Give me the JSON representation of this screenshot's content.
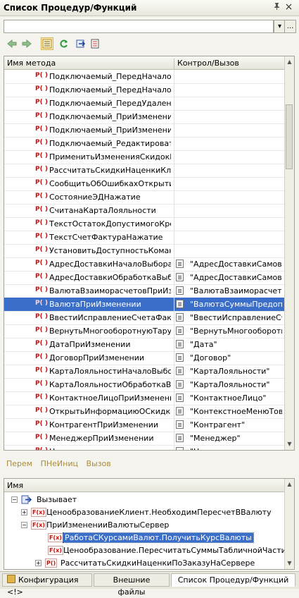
{
  "window": {
    "title": "Список Процедур/Функций",
    "pin_icon": "pin-icon",
    "close_glyph": "×"
  },
  "search": {
    "value": "",
    "dots": "...",
    "dropdown": "▾"
  },
  "grid": {
    "columns": [
      "Имя метода",
      "Контрол/Вызов"
    ],
    "rows": [
      {
        "name": "Подключаемый_ПередНачало...",
        "control": ""
      },
      {
        "name": "Подключаемый_ПередНачало...",
        "control": ""
      },
      {
        "name": "Подключаемый_ПередУдален...",
        "control": ""
      },
      {
        "name": "Подключаемый_ПриИзменени...",
        "control": ""
      },
      {
        "name": "Подключаемый_ПриИзменени...",
        "control": ""
      },
      {
        "name": "Подключаемый_Редактироват...",
        "control": ""
      },
      {
        "name": "ПрименитьИзмененияСкидокН...",
        "control": ""
      },
      {
        "name": "РассчитатьСкидкиНаценкиКли...",
        "control": ""
      },
      {
        "name": "СообщитьОбОшибкахОткрытия...",
        "control": ""
      },
      {
        "name": "СостояниеЭДНажатие",
        "control": ""
      },
      {
        "name": "СчитанаКартаЛояльности",
        "control": ""
      },
      {
        "name": "ТекстОстатокДопустимогоКре...",
        "control": ""
      },
      {
        "name": "ТекстСчетФактураНажатие",
        "control": ""
      },
      {
        "name": "УстановитьДоступностьКоман...",
        "control": ""
      },
      {
        "name": "АдресДоставкиНачалоВыбора",
        "control": "\"АдресДоставкиСамов..."
      },
      {
        "name": "АдресДоставкиОбработкаВыб...",
        "control": "\"АдресДоставкиСамов..."
      },
      {
        "name": "ВалютаВзаиморасчетовПриИз...",
        "control": "\"ВалютаВзаиморасчет..."
      },
      {
        "name": "ВалютаПриИзменении",
        "control": "\"ВалютаСуммыПредоп...",
        "selected": true
      },
      {
        "name": "ВвестиИсправлениеСчетаФак...",
        "control": "\"ВвестиИсправлениеСч..."
      },
      {
        "name": "ВернутьМногооборотнуюТаруП...",
        "control": "\"ВернутьМногооборотн..."
      },
      {
        "name": "ДатаПриИзменении",
        "control": "\"Дата\""
      },
      {
        "name": "ДоговорПриИзменении",
        "control": "\"Договор\""
      },
      {
        "name": "КартаЛояльностиНачалоВыбора",
        "control": "\"КартаЛояльности\""
      },
      {
        "name": "КартаЛояльностиОбработкаВ...",
        "control": "\"КартаЛояльности\""
      },
      {
        "name": "КонтактноеЛицоПриИзменении",
        "control": "\"КонтактноеЛицо\""
      },
      {
        "name": "ОткрытьИнформациюОСкидках",
        "control": "\"КонтекстноеМенюТов..."
      },
      {
        "name": "КонтрагентПриИзменении",
        "control": "\"Контрагент\""
      },
      {
        "name": "МенеджерПриИзменении",
        "control": "\"Менеджер\""
      },
      {
        "name": "Н...",
        "control": "\"Н..."
      }
    ]
  },
  "links": [
    "Перем",
    "ПНеИниц",
    "Вызов"
  ],
  "tree": {
    "header": "Имя",
    "nodes": [
      {
        "label": "Вызывает",
        "icon": "arrow-icon",
        "expander": "−"
      },
      {
        "label": "ЦенообразованиеКлиент.НеобходимПересчетВВалюту",
        "icon": "F(x)",
        "expander": "+"
      },
      {
        "label": "ПриИзмененииВалютыСервер",
        "icon": "F(x)",
        "expander": "−"
      },
      {
        "label": "РаботаСКурсамиВалют.ПолучитьКурсВалюты",
        "icon": "F(x)",
        "expander": "",
        "selected": true
      },
      {
        "label": "Ценообразование.ПересчитатьСуммыТабличнойЧастиВВ...",
        "icon": "F(x)",
        "expander": ""
      },
      {
        "label": "РассчитатьСкидкиНаценкиПоЗаказуНаСервере",
        "icon": "P()",
        "expander": "+"
      }
    ]
  },
  "tabs": [
    {
      "label": "Конфигурация <!>",
      "active": false
    },
    {
      "label": "Внешние файлы",
      "active": false
    },
    {
      "label": "Список Процедур/Функций",
      "active": true
    }
  ]
}
